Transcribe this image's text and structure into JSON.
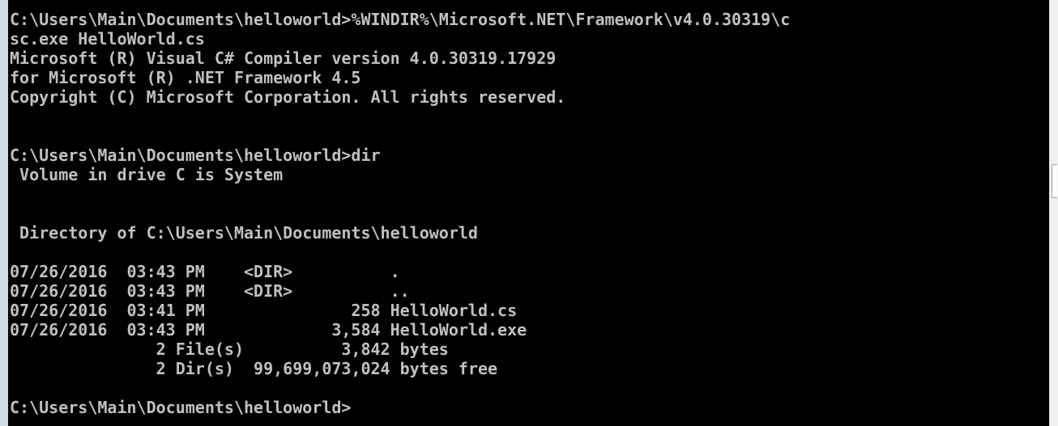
{
  "console": {
    "colors": {
      "background": "#000000",
      "text": "#c0c0c0",
      "frame": "#d4dbe6"
    },
    "lines": [
      "C:\\Users\\Main\\Documents\\helloworld>%WINDIR%\\Microsoft.NET\\Framework\\v4.0.30319\\c",
      "sc.exe HelloWorld.cs",
      "Microsoft (R) Visual C# Compiler version 4.0.30319.17929",
      "for Microsoft (R) .NET Framework 4.5",
      "Copyright (C) Microsoft Corporation. All rights reserved.",
      "",
      "",
      "C:\\Users\\Main\\Documents\\helloworld>dir",
      " Volume in drive C is System",
      "",
      "",
      " Directory of C:\\Users\\Main\\Documents\\helloworld",
      "",
      "07/26/2016  03:43 PM    <DIR>          .",
      "07/26/2016  03:43 PM    <DIR>          ..",
      "07/26/2016  03:41 PM               258 HelloWorld.cs",
      "07/26/2016  03:43 PM             3,584 HelloWorld.exe",
      "               2 File(s)          3,842 bytes",
      "               2 Dir(s)  99,699,073,024 bytes free",
      "",
      "C:\\Users\\Main\\Documents\\helloworld>"
    ]
  }
}
